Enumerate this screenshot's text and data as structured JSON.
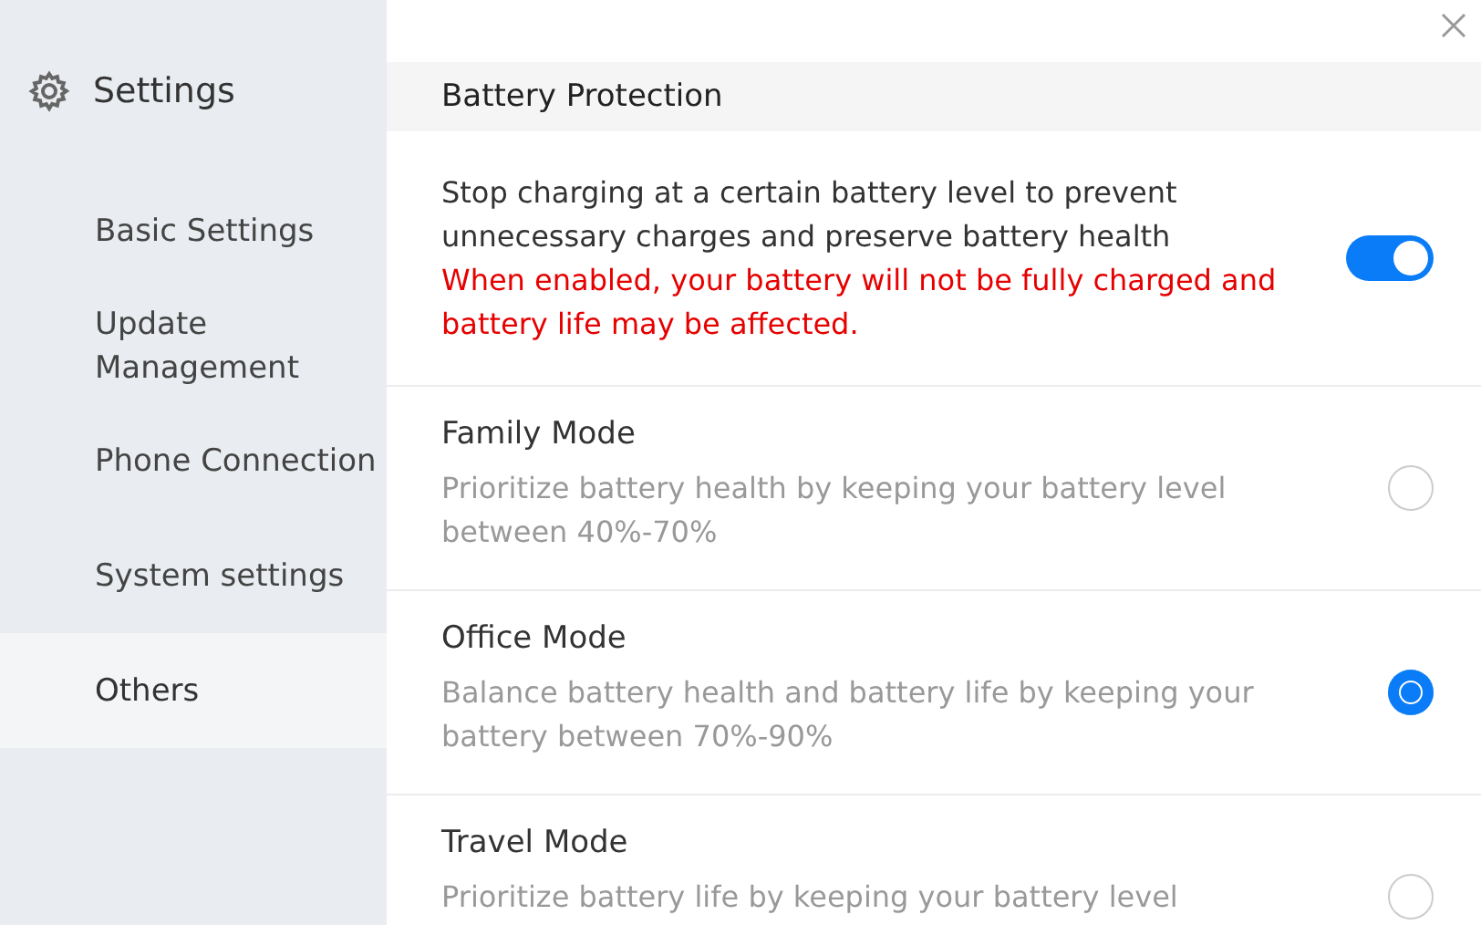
{
  "sidebar": {
    "title": "Settings",
    "items": [
      {
        "label": "Basic Settings",
        "selected": false
      },
      {
        "label": "Update\nManagement",
        "selected": false
      },
      {
        "label": "Phone Connection",
        "selected": false
      },
      {
        "label": "System settings",
        "selected": false
      },
      {
        "label": "Others",
        "selected": true
      }
    ]
  },
  "section": {
    "title": "Battery Protection",
    "toggle": {
      "description": "Stop charging at a certain battery level to prevent unnecessary charges and preserve battery health",
      "warning": "When enabled, your battery will not be fully charged and battery life may be affected.",
      "on": true
    },
    "modes": [
      {
        "name": "Family Mode",
        "description": "Prioritize battery health by keeping your battery level between 40%-70%",
        "selected": false
      },
      {
        "name": "Office Mode",
        "description": "Balance battery health and battery life by keeping your battery between 70%-90%",
        "selected": true
      },
      {
        "name": "Travel Mode",
        "description": "Prioritize battery life by keeping your battery level",
        "selected": false
      }
    ]
  }
}
